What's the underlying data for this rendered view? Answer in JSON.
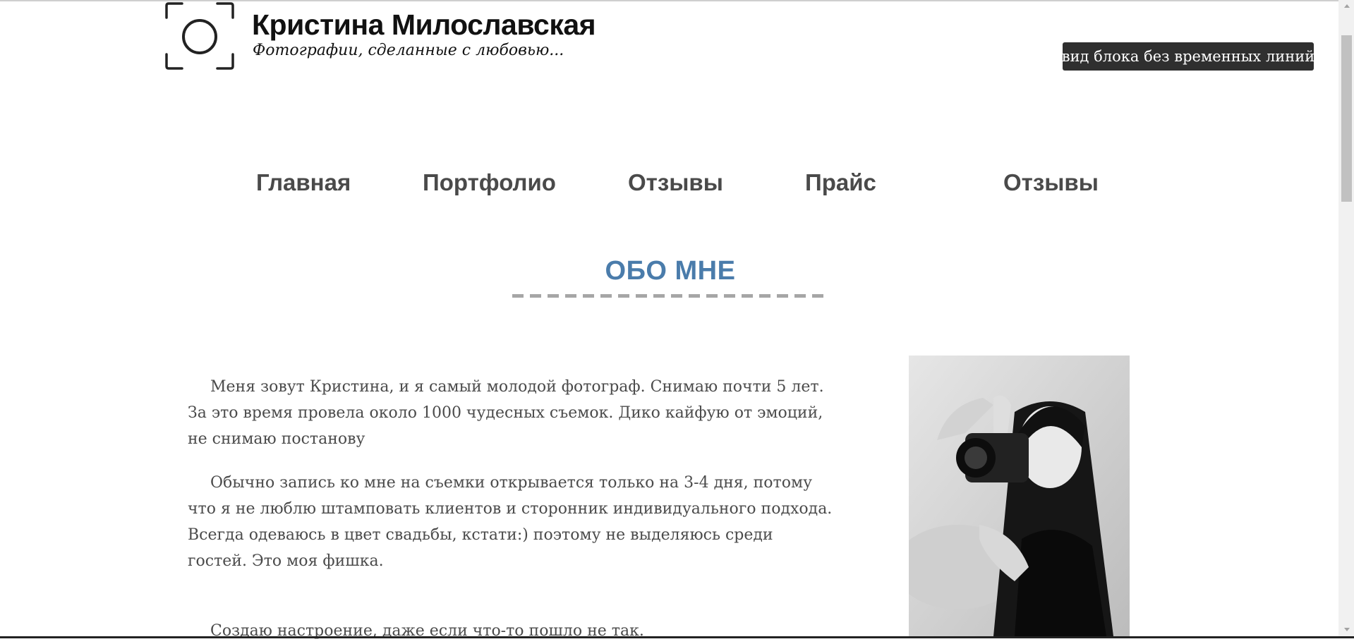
{
  "header": {
    "title": "Кристина Милославская",
    "tagline": "Фотографии, сделанные с любовью..."
  },
  "view_toggle": {
    "label": "вид блока без временных линий"
  },
  "nav": {
    "items": [
      {
        "label": "Главная"
      },
      {
        "label": "Портфолио"
      },
      {
        "label": "Отзывы"
      },
      {
        "label": "Прайс"
      },
      {
        "label": "Отзывы"
      }
    ]
  },
  "about": {
    "title": "ОБО МНЕ",
    "p1": "Меня зовут Кристина, и я самый молодой фотограф. Снимаю почти 5 лет. За это время провела около 1000 чудесных съемок. Дико кайфую от эмоций, не снимаю постанову",
    "p2_line1": "Обычно запись ко мне на съемки открывается только на 3-4 дня, потому что я не люблю штамповать клиентов и сторонник индивидуального подхода.",
    "p2_line2": "Всегда одеваюсь в цвет свадьбы, кстати:) поэтому не выделяюсь среди гостей. Это моя фишка.",
    "p3": "Создаю настроение, даже если что-то пошло не так."
  },
  "colors": {
    "accent": "#4a7cab",
    "nav_text": "#4a4a4a",
    "button_bg": "#2f2f2f",
    "body_text": "#4b4b4b"
  },
  "icons": {
    "logo": "camera-frame-icon"
  }
}
